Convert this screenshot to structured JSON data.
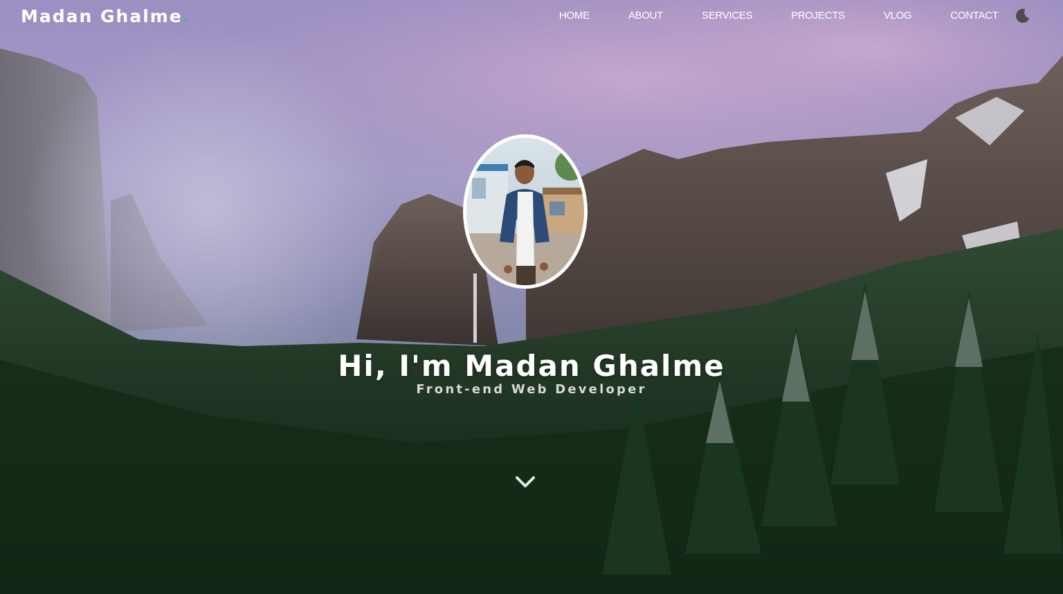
{
  "brand": {
    "name": "Madan Ghalme",
    "dot_color": "#2ecc71"
  },
  "nav": {
    "items": [
      {
        "label": "HOME"
      },
      {
        "label": "ABOUT"
      },
      {
        "label": "SERVICES"
      },
      {
        "label": "PROJECTS"
      },
      {
        "label": "VLOG"
      },
      {
        "label": "CONTACT"
      }
    ],
    "theme_icon": "moon-icon"
  },
  "hero": {
    "headline": "Hi, I'm Madan Ghalme",
    "subtitle": "Front-end Web Developer",
    "avatar_icon": "profile-photo",
    "scroll_icon": "chevron-down-icon",
    "background": "mountain-valley-forest-photo"
  },
  "colors": {
    "text": "#ffffff",
    "subtitle": "#d9d9d9",
    "accent": "#2ecc71",
    "moon": "#4d4d4d"
  }
}
